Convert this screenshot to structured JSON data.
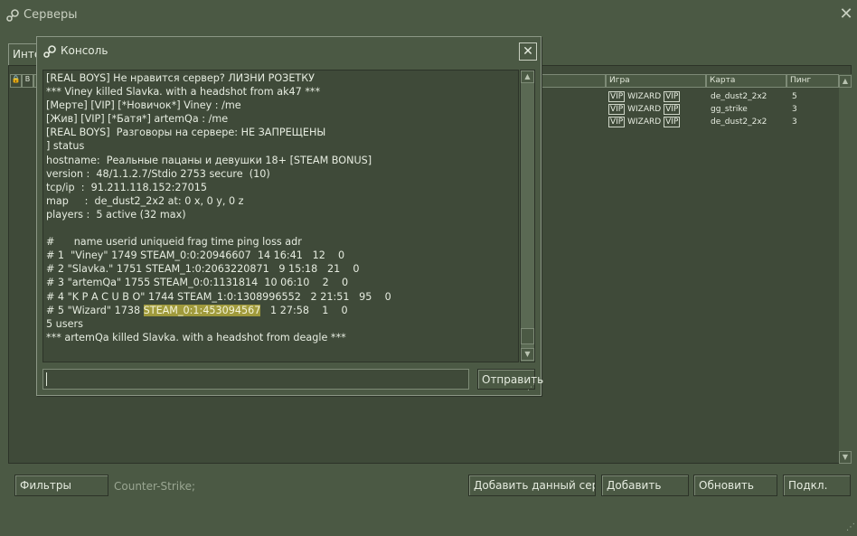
{
  "window": {
    "title": "Серверы",
    "icon": "steam-icon",
    "close_glyph": "✕"
  },
  "tabs": {
    "partial_label": "Инте"
  },
  "server_list": {
    "columns": {
      "game": "Игра",
      "map": "Карта",
      "ping": "Пинг"
    },
    "rows": [
      {
        "vip1": "VIP",
        "name": "WIZARD",
        "vip2": "VIP",
        "map": "de_dust2_2x2",
        "ping": "5"
      },
      {
        "vip1": "VIP",
        "name": "WIZARD",
        "vip2": "VIP",
        "map": "gg_strike",
        "ping": "3"
      },
      {
        "vip1": "VIP",
        "name": "WIZARD",
        "vip2": "VIP",
        "map": "de_dust2_2x2",
        "ping": "3"
      }
    ]
  },
  "bottom_bar": {
    "filters_label": "Фильтры",
    "filter_text": "Counter-Strike;",
    "add_current_label": "Добавить данный серве",
    "add_label": "Добавить",
    "refresh_label": "Обновить",
    "connect_label": "Подкл."
  },
  "console": {
    "title": "Консоль",
    "close_glyph": "✕",
    "send_label": "Отправить",
    "input_value": "",
    "lines": [
      "[REAL BOYS] Не нравится сервер? ЛИЗНИ РОЗЕТКУ",
      "*** Viney killed Slavka. with a headshot from ak47 ***",
      "[Мерте] [VIP] [*Новичок*] Viney : /me",
      "[Жив] [VIP] [*Батя*] artemQa : /me",
      "[REAL BOYS]  Разговоры на сервере: НЕ ЗАПРЕЩЕНЫ",
      "] status",
      "hostname:  Реальные пацаны и девушки 18+ [STEAM BONUS]",
      "version :  48/1.1.2.7/Stdio 2753 secure  (10)",
      "tcp/ip  :  91.211.118.152:27015",
      "map     :  de_dust2_2x2 at: 0 x, 0 y, 0 z",
      "players :  5 active (32 max)",
      "",
      "#      name userid uniqueid frag time ping loss adr",
      "# 1  \"Viney\" 1749 STEAM_0:0:20946607  14 16:41   12    0",
      "# 2 \"Slavka.\" 1751 STEAM_1:0:2063220871   9 15:18   21    0",
      "# 3 \"artemQa\" 1755 STEAM_0:0:1131814  10 06:10    2    0",
      "# 4 \"K P A C U B O\" 1744 STEAM_1:0:1308996552   2 21:51   95    0"
    ],
    "line5_prefix": "# 5 \"Wizard\" 1738 ",
    "line5_highlight": "STEAM_0:1:453094567",
    "line5_suffix": "   1 27:58    1    0",
    "after_lines": [
      "5 users",
      "*** artemQa killed Slavka. with a headshot from deagle ***"
    ]
  },
  "colors": {
    "background": "#4b5944",
    "panel": "#3f4a39",
    "highlight": "#a09a3c",
    "text": "#e6ece0"
  }
}
